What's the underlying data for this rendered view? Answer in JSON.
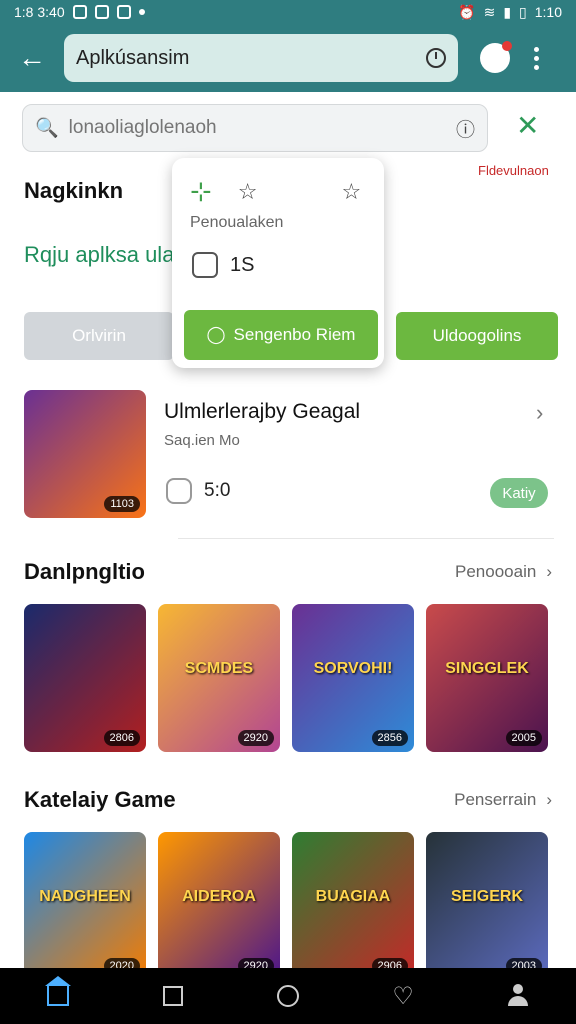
{
  "status_bar": {
    "left_time": "1:8 3:40",
    "right_time": "1:10"
  },
  "app_bar": {
    "title": "Aplkúsansim",
    "back_icon": "arrow-left-icon",
    "profile_icon": "profile-icon",
    "more_icon": "more-vert-icon"
  },
  "search": {
    "placeholder": "lonaoliaglolenaoh",
    "clear_icon": "close-icon"
  },
  "header": {
    "title": "Nagkinkn",
    "link": "Fldevulnaon"
  },
  "green_note": "Rqju aplksa ulat",
  "popup": {
    "label": "Penoualaken",
    "count": "1S",
    "button": "Sengenbo Riem"
  },
  "chips": {
    "left": "Orlvirin",
    "right": "Uldoogolins"
  },
  "featured": {
    "title": "Ulmlerlerajby Geagal",
    "subtitle": "Saq.ien Mo",
    "stat": "5:0",
    "button": "Katiy",
    "rating": "1103"
  },
  "rows": [
    {
      "title": "Danlpngltio",
      "more": "Penoooain",
      "items": [
        {
          "caption": "",
          "rating": "2806",
          "colors": [
            "#1a2a6c",
            "#b21f1f"
          ]
        },
        {
          "caption": "SCMDES",
          "rating": "2920",
          "colors": [
            "#f7b733",
            "#b24592"
          ]
        },
        {
          "caption": "SORVOHI!",
          "rating": "2856",
          "colors": [
            "#6a3093",
            "#2e8bd8"
          ]
        },
        {
          "caption": "SINGGLEK",
          "rating": "2005",
          "colors": [
            "#c94b4b",
            "#4b134f"
          ]
        }
      ]
    },
    {
      "title": "Katelaiy Game",
      "more": "Penserrain",
      "items": [
        {
          "caption": "NADGHEEN",
          "rating": "2020",
          "colors": [
            "#1e88e5",
            "#f57c00"
          ]
        },
        {
          "caption": "AIDEROA",
          "rating": "2920",
          "colors": [
            "#ff9800",
            "#4a148c"
          ]
        },
        {
          "caption": "BUAGIAA",
          "rating": "2906",
          "colors": [
            "#2e7d32",
            "#c62828"
          ]
        },
        {
          "caption": "SEIGERK",
          "rating": "2003",
          "colors": [
            "#263238",
            "#5c6bc0"
          ]
        }
      ]
    }
  ],
  "nav": [
    "home-icon",
    "square-icon",
    "circle-icon",
    "heart-icon",
    "person-icon"
  ]
}
